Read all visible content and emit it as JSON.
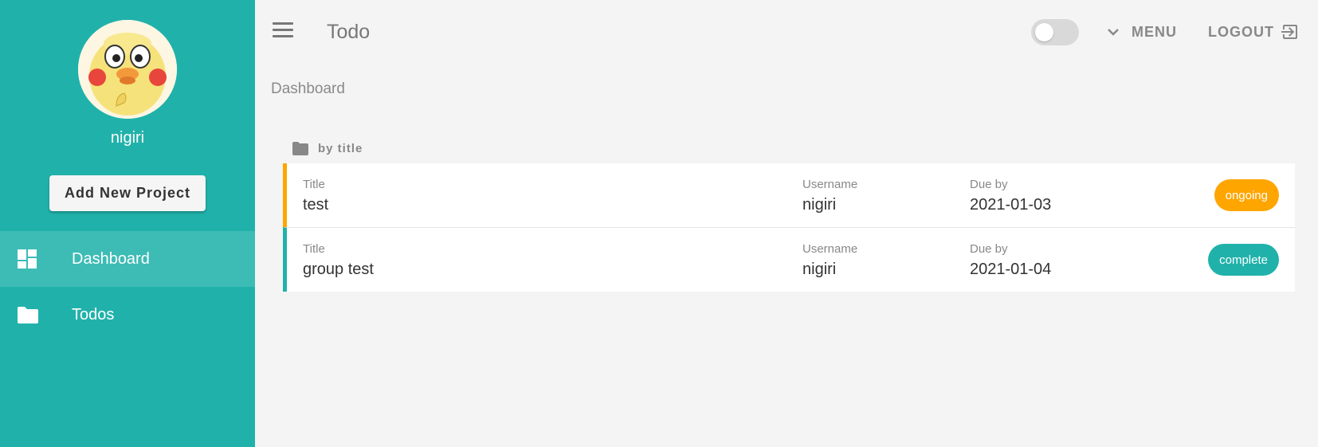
{
  "app": {
    "title": "Todo"
  },
  "sidebar": {
    "username": "nigiri",
    "add_button": "Add New Project",
    "items": [
      {
        "label": "Dashboard",
        "icon": "dashboard-icon",
        "active": true
      },
      {
        "label": "Todos",
        "icon": "folder-icon",
        "active": false
      }
    ]
  },
  "header": {
    "menu_label": "MENU",
    "logout_label": "LOGOUT"
  },
  "breadcrumb": "Dashboard",
  "group": {
    "label": "by title"
  },
  "todos": [
    {
      "title_label": "Title",
      "title": "test",
      "user_label": "Username",
      "username": "nigiri",
      "due_label": "Due by",
      "due": "2021-01-03",
      "status": "ongoing"
    },
    {
      "title_label": "Title",
      "title": "group test",
      "user_label": "Username",
      "username": "nigiri",
      "due_label": "Due by",
      "due": "2021-01-04",
      "status": "complete"
    }
  ],
  "colors": {
    "accent": "#20b2aa",
    "ongoing": "#ffa500",
    "complete": "#20b2aa",
    "background": "#f4f4f4"
  }
}
